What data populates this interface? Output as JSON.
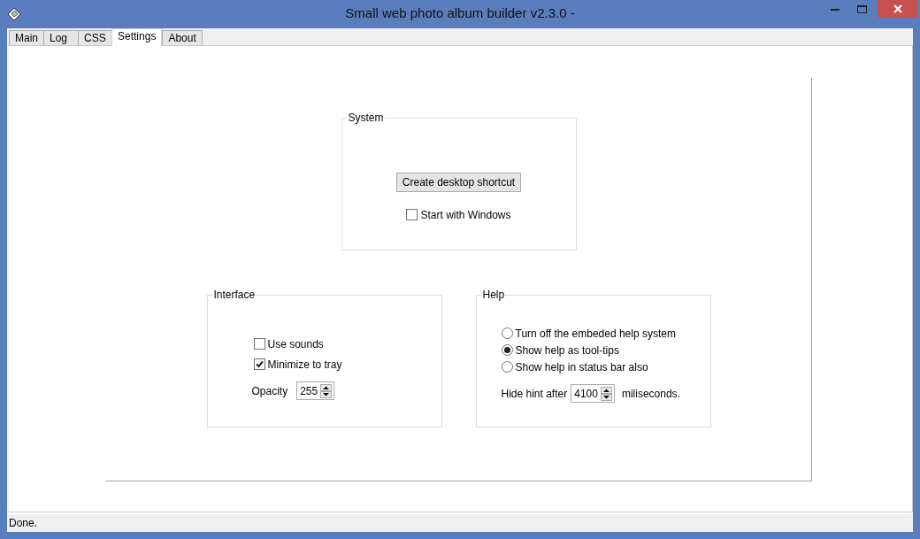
{
  "window": {
    "title": "Small web photo album builder v2.3.0 -"
  },
  "tabs": [
    {
      "label": "Main",
      "selected": false
    },
    {
      "label": "Log",
      "selected": false
    },
    {
      "label": "CSS",
      "selected": false
    },
    {
      "label": "Settings",
      "selected": true
    },
    {
      "label": "About",
      "selected": false
    }
  ],
  "system": {
    "title": "System",
    "button": "Create desktop shortcut",
    "options": [
      {
        "label": "Start with Windows",
        "checked": false
      }
    ]
  },
  "interface": {
    "title": "Interface",
    "options": [
      {
        "label": "Use sounds",
        "checked": false
      },
      {
        "label": "Minimize to tray",
        "checked": true
      }
    ],
    "opacity": {
      "label": "Opacity",
      "value": "255"
    }
  },
  "help": {
    "title": "Help",
    "options": [
      {
        "label": "Turn off the embeded help system",
        "selected": false
      },
      {
        "label": "Show help as tool-tips",
        "selected": true
      },
      {
        "label": "Show help in status bar also",
        "selected": false
      }
    ],
    "hide_hint": {
      "label": "Hide hint after",
      "value": "4100",
      "suffix": "miliseconds."
    }
  },
  "status_bar": {
    "text": "Done."
  }
}
